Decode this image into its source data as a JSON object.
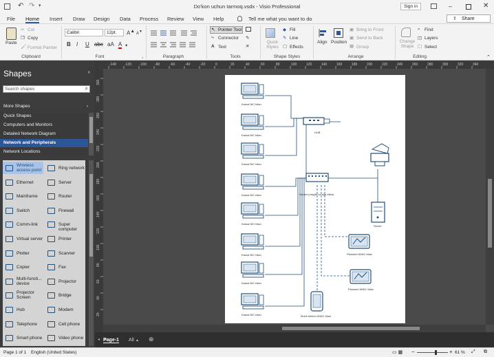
{
  "window": {
    "title": "Do'kon uchun tarmoq.vsdx  -  Visio Professional",
    "sign_in": "Sign in",
    "share": "Share"
  },
  "tabs": [
    "File",
    "Home",
    "Insert",
    "Draw",
    "Design",
    "Data",
    "Process",
    "Review",
    "View",
    "Help"
  ],
  "tell_me": "Tell me what you want to do",
  "clipboard": {
    "paste": "Paste",
    "cut": "Cut",
    "copy": "Copy",
    "format_painter": "Format Painter",
    "label": "Clipboard"
  },
  "font": {
    "name": "Calibri",
    "size": "12pt.",
    "label": "Font"
  },
  "paragraph": {
    "label": "Paragraph"
  },
  "tools": {
    "pointer": "Pointer Tool",
    "connector": "Connector",
    "text": "Text",
    "label": "Tools"
  },
  "shape_styles": {
    "quick": "Quick Styles",
    "fill": "Fill",
    "line": "Line",
    "effects": "Effects",
    "label": "Shape Styles"
  },
  "arrange": {
    "align": "Align",
    "position": "Position",
    "bring_front": "Bring to Front",
    "send_back": "Send to Back",
    "group": "Group",
    "label": "Arrange"
  },
  "editing": {
    "change_shape": "Change Shape",
    "find": "Find",
    "layers": "Layers",
    "select": "Select",
    "label": "Editing"
  },
  "shapes_panel": {
    "title": "Shapes",
    "search_placeholder": "Search shapes",
    "more": "More Shapes",
    "stencils": [
      "Quick Shapes",
      "Computers and Monitors",
      "Detailed Network Diagram",
      "Network and Peripherals",
      "Network Locations"
    ],
    "items": [
      [
        "Wireless access point",
        "Ring network"
      ],
      [
        "Ethernet",
        "Server"
      ],
      [
        "Mainframe",
        "Router"
      ],
      [
        "Switch",
        "Firewall"
      ],
      [
        "Comm-link",
        "Super computer"
      ],
      [
        "Virtual server",
        "Printer"
      ],
      [
        "Plotter",
        "Scanner"
      ],
      [
        "Copier",
        "Fax"
      ],
      [
        "Multi-functi... device",
        "Projector"
      ],
      [
        "Projector Screen",
        "Bridge"
      ],
      [
        "Hub",
        "Modem"
      ],
      [
        "Telephone",
        "Cell phone"
      ],
      [
        "Smart phone",
        "Video phone"
      ]
    ]
  },
  "ruler": {
    "h": [
      "-140",
      "-120",
      "-100",
      "-80",
      "-60",
      "-40",
      "-20",
      "0",
      "20",
      "40",
      "60",
      "80",
      "100",
      "120",
      "140",
      "160",
      "180",
      "200",
      "220",
      "240",
      "260",
      "280",
      "300",
      "320",
      "340"
    ],
    "v": [
      "300",
      "280",
      "260",
      "240",
      "220",
      "200",
      "180",
      "160",
      "140",
      "120",
      "100",
      "80",
      "60",
      "40",
      "20"
    ]
  },
  "diagram": {
    "pc_label": "Kassa NIC bilan",
    "hub": "HUB",
    "router": "Router (mayjet va aga bilan)",
    "server": "Server",
    "tablet1": "Planshet WNIC bilan",
    "tablet2": "Planshet WNIC bilan",
    "phone": "Mobil telefon WNIC bilan"
  },
  "page_tabs": {
    "page": "Page-1",
    "all": "All"
  },
  "status": {
    "page": "Page 1 of 1",
    "lang": "English (United States)",
    "zoom": "61 %"
  }
}
